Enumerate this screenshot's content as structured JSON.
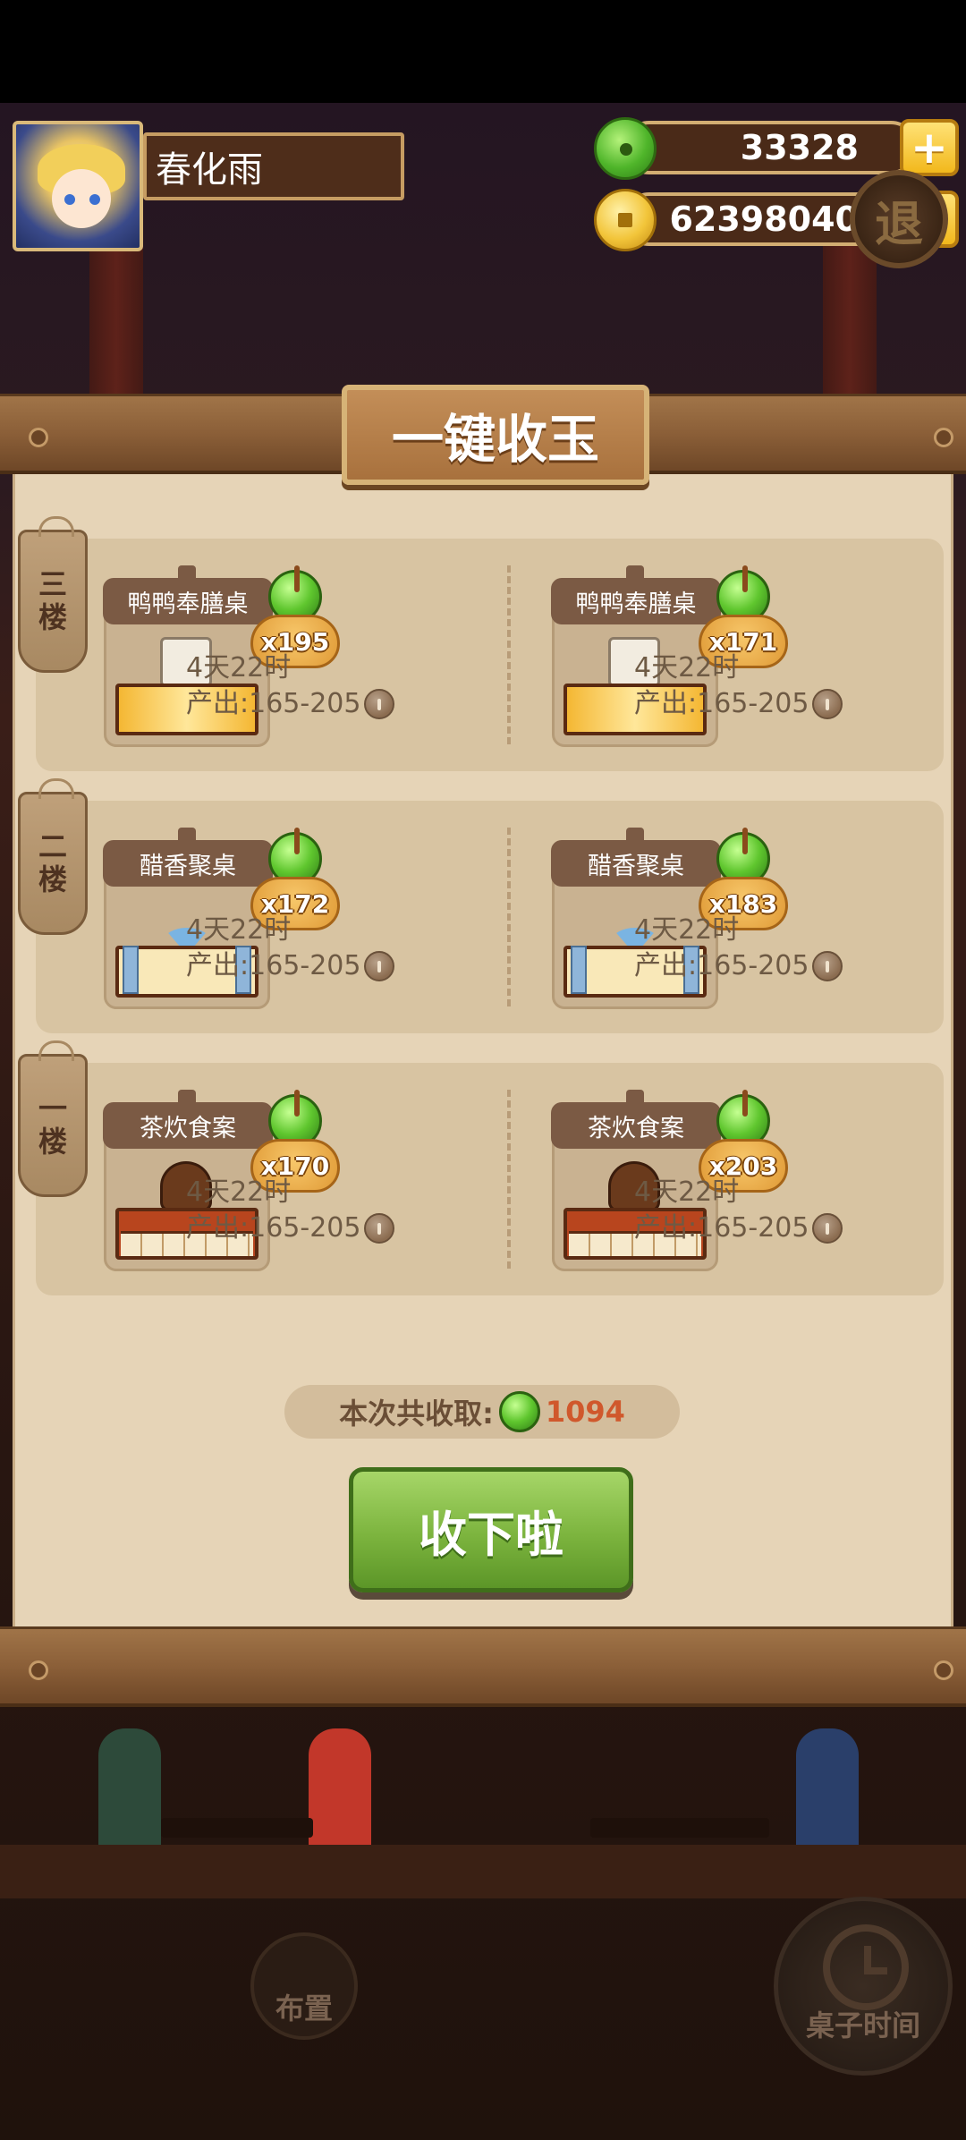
{
  "player": {
    "name": "春化雨"
  },
  "currency": {
    "jade": "33328",
    "coins": "62398040"
  },
  "exit_label": "退",
  "modal": {
    "title": "一键收玉",
    "floors": [
      {
        "tag": [
          "三",
          "楼"
        ],
        "tables": [
          {
            "name": "鸭鸭奉膳桌",
            "reward": "x195",
            "time": "4天22时",
            "output": "产出:165-205"
          },
          {
            "name": "鸭鸭奉膳桌",
            "reward": "x171",
            "time": "4天22时",
            "output": "产出:165-205"
          }
        ]
      },
      {
        "tag": [
          "二",
          "楼"
        ],
        "tables": [
          {
            "name": "醋香聚桌",
            "reward": "x172",
            "time": "4天22时",
            "output": "产出:165-205"
          },
          {
            "name": "醋香聚桌",
            "reward": "x183",
            "time": "4天22时",
            "output": "产出:165-205"
          }
        ]
      },
      {
        "tag": [
          "一",
          "楼"
        ],
        "tables": [
          {
            "name": "茶炊食案",
            "reward": "x170",
            "time": "4天22时",
            "output": "产出:165-205"
          },
          {
            "name": "茶炊食案",
            "reward": "x203",
            "time": "4天22时",
            "output": "产出:165-205"
          }
        ]
      }
    ],
    "total_label": "本次共收取:",
    "total_value": "1094",
    "collect_label": "收下啦"
  },
  "bottom_nav": {
    "layout_label": "布置",
    "table_time_label": "桌子时间"
  },
  "icons": {
    "jade": "jade-icon",
    "coin": "coin-icon",
    "plus": "plus-icon",
    "clock": "clock-icon"
  },
  "colors": {
    "accent_green": "#7cb43e",
    "reward_orange": "#e09a36",
    "total_value": "#d0582c",
    "panel_bg": "#e6d4b7"
  }
}
